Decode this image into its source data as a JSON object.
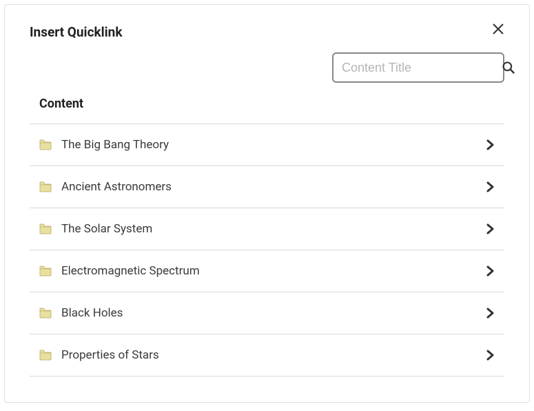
{
  "dialog": {
    "title": "Insert Quicklink"
  },
  "search": {
    "placeholder": "Content Title"
  },
  "section": {
    "header": "Content"
  },
  "items": [
    {
      "label": "The Big Bang Theory"
    },
    {
      "label": "Ancient Astronomers"
    },
    {
      "label": "The Solar System"
    },
    {
      "label": "Electromagnetic Spectrum"
    },
    {
      "label": "Black Holes"
    },
    {
      "label": "Properties of Stars"
    }
  ]
}
